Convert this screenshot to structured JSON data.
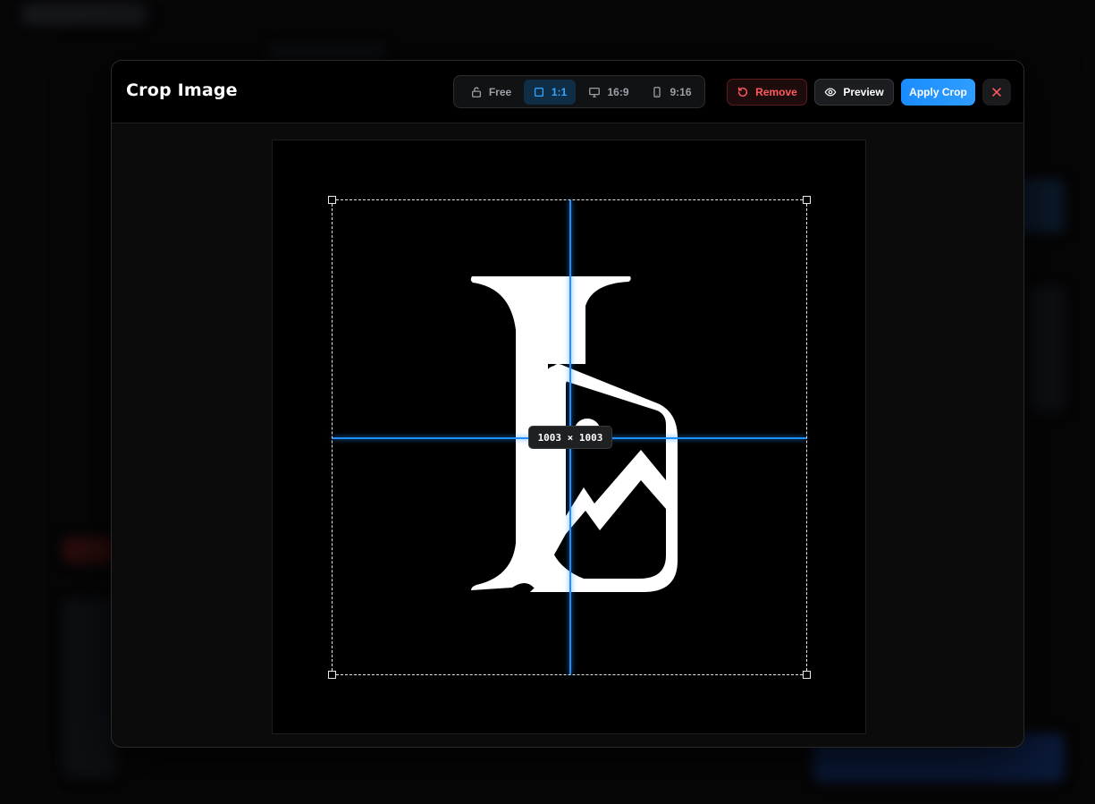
{
  "modal": {
    "title": "Crop Image"
  },
  "aspect_ratios": [
    {
      "label": "Free",
      "icon": "lock-open-icon",
      "selected": false
    },
    {
      "label": "1:1",
      "icon": "square-icon",
      "selected": true
    },
    {
      "label": "16:9",
      "icon": "monitor-icon",
      "selected": false
    },
    {
      "label": "9:16",
      "icon": "phone-icon",
      "selected": false
    }
  ],
  "actions": {
    "remove_label": "Remove",
    "preview_label": "Preview",
    "apply_label": "Apply Crop"
  },
  "crop": {
    "size_label": "1003 × 1003"
  },
  "colors": {
    "accent": "#1f8fff",
    "danger": "#ff5a5f",
    "selected_bg": "#0f2d45"
  }
}
